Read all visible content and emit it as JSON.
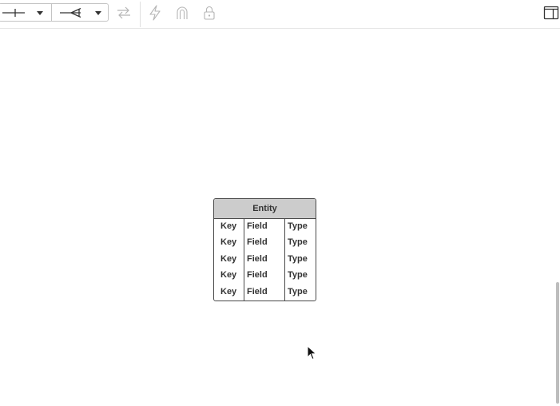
{
  "toolbar": {
    "start_arrow": {
      "icon": "line-start-bar-icon"
    },
    "end_arrow": {
      "icon": "line-end-crowsfoot-icon"
    },
    "buttons": [
      {
        "name": "swap-ends-icon",
        "enabled": false
      },
      {
        "name": "lightning-icon",
        "enabled": false
      },
      {
        "name": "magnet-icon",
        "enabled": false
      },
      {
        "name": "lock-icon",
        "enabled": false
      }
    ],
    "right_button": {
      "name": "panel-toggle-icon"
    }
  },
  "entity": {
    "title": "Entity",
    "rows": [
      {
        "key": "Key",
        "field": "Field",
        "type": "Type"
      },
      {
        "key": "Key",
        "field": "Field",
        "type": "Type"
      },
      {
        "key": "Key",
        "field": "Field",
        "type": "Type"
      },
      {
        "key": "Key",
        "field": "Field",
        "type": "Type"
      },
      {
        "key": "Key",
        "field": "Field",
        "type": "Type"
      }
    ]
  },
  "colors": {
    "header_fill": "#cccccc",
    "border": "#4a4a4a",
    "disabled_icon": "#b5b5b5"
  }
}
